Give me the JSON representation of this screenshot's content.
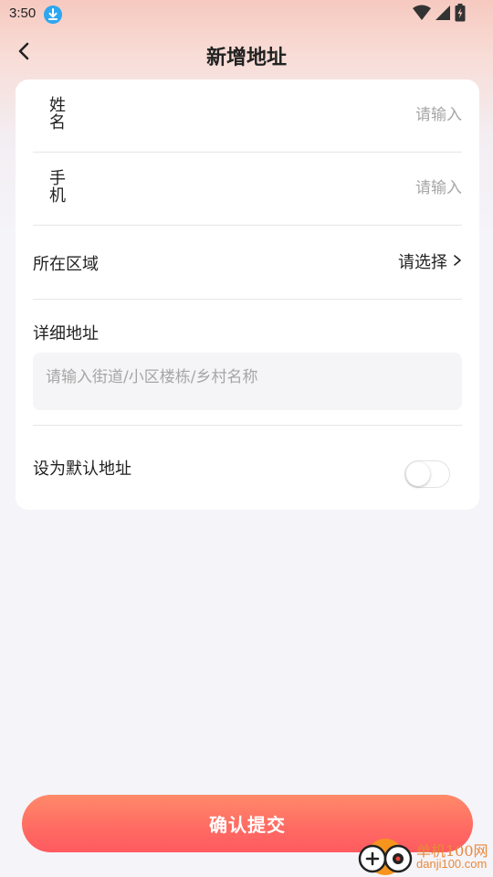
{
  "status_bar": {
    "time": "3:50",
    "icons": [
      "download-icon",
      "wifi-icon",
      "signal-icon",
      "battery-icon"
    ]
  },
  "header": {
    "title": "新增地址",
    "back_icon": "chevron-left-icon"
  },
  "form": {
    "name": {
      "label_chars": [
        "姓",
        "名"
      ],
      "placeholder": "请输入",
      "value": ""
    },
    "phone": {
      "label_chars": [
        "手",
        "机"
      ],
      "placeholder": "请输入",
      "value": ""
    },
    "region": {
      "label": "所在区域",
      "select_text": "请选择",
      "select_icon": "chevron-right-icon"
    },
    "detail": {
      "label": "详细地址",
      "placeholder": "请输入街道/小区楼栋/乡村名称",
      "value": ""
    },
    "default_address": {
      "label": "设为默认地址",
      "checked": false
    }
  },
  "submit": {
    "label": "确认提交"
  },
  "watermark": {
    "site_name": "单机100网",
    "url": "danji100.com"
  },
  "colors": {
    "accent_start": "#ff8a6a",
    "accent_end": "#ff5a60",
    "page_bg": "#f5f4f9",
    "card_bg": "#ffffff",
    "placeholder": "#a6a6a6"
  }
}
